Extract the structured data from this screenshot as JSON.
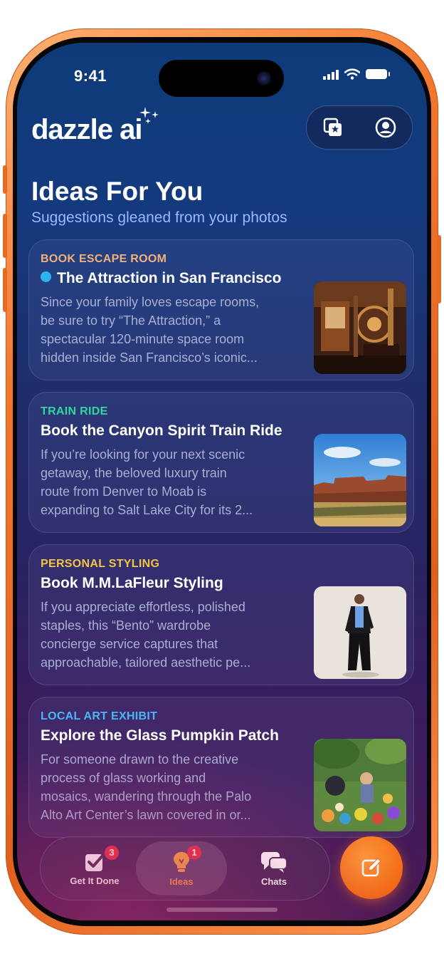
{
  "status_bar": {
    "time": "9:41"
  },
  "header": {
    "logo_text": "dazzle ai",
    "saved_icon": "bookmark-star-icon",
    "profile_icon": "person-circle-icon"
  },
  "page": {
    "title": "Ideas For You",
    "subtitle": "Suggestions gleaned from your photos"
  },
  "colors": {
    "accent_orange": "#f36b17",
    "unread_dot": "#2fb3f0",
    "badge_red": "#e63046"
  },
  "cards": [
    {
      "category": "BOOK ESCAPE ROOM",
      "category_color": "#f3b07a",
      "unread": true,
      "title": "The Attraction in San Francisco",
      "description_lines": [
        "Since your family loves escape rooms,",
        "be sure to try “The Attraction,” a",
        "spectacular 120-minute space room",
        "hidden inside San Francisco’s iconic..."
      ],
      "image": "escape-room-photo"
    },
    {
      "category": "TRAIN RIDE",
      "category_color": "#35d3a4",
      "unread": false,
      "title": "Book the Canyon Spirit Train Ride",
      "description_lines": [
        "If you’re looking for your next scenic",
        "getaway, the beloved luxury train",
        "route from Denver to Moab is",
        "expanding to Salt Lake City for its 2..."
      ],
      "image": "canyon-landscape-photo"
    },
    {
      "category": "PERSONAL STYLING",
      "category_color": "#f3c447",
      "unread": false,
      "title": "Book M.M.LaFleur Styling",
      "description_lines": [
        "If you appreciate effortless, polished",
        "staples, this “Bento” wardrobe",
        "concierge service captures that",
        "approachable, tailored aesthetic pe..."
      ],
      "image": "fashion-model-photo"
    },
    {
      "category": "LOCAL ART EXHIBIT",
      "category_color": "#49b6f5",
      "unread": false,
      "title": "Explore the Glass Pumpkin Patch",
      "description_lines": [
        "For someone drawn to the creative",
        "process of glass working and",
        "mosaics, wandering through the Palo",
        "Alto Art Center’s lawn covered in or..."
      ],
      "image": "glass-pumpkin-patch-photo"
    }
  ],
  "tab_bar": {
    "tabs": [
      {
        "label": "Get It Done",
        "icon": "checkbox-icon",
        "badge": "3",
        "active": false
      },
      {
        "label": "Ideas",
        "icon": "lightbulb-icon",
        "badge": "1",
        "active": true
      },
      {
        "label": "Chats",
        "icon": "chat-bubbles-icon",
        "badge": "",
        "active": false
      }
    ],
    "compose_icon": "compose-icon"
  }
}
